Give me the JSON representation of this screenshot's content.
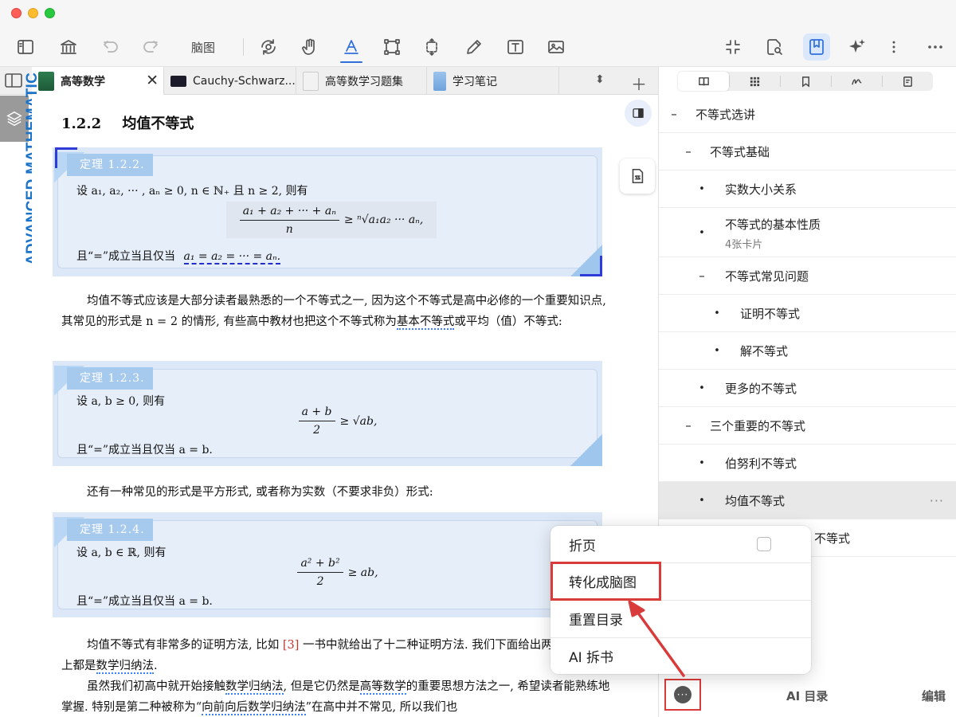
{
  "toolbar": {
    "mindmap_label": "脑图"
  },
  "tabs": [
    {
      "label": "高等数学",
      "active": true
    },
    {
      "label": "Cauchy-Schwarz...",
      "active": false
    },
    {
      "label": "高等数学习题集",
      "active": false
    },
    {
      "label": "学习笔记",
      "active": false
    }
  ],
  "spine_text": "ADVANCED MATHEMATIC",
  "doc": {
    "section_number": "1.2.2",
    "section_title": "均值不等式",
    "theorems": [
      {
        "tag": "定理 1.2.2.",
        "line1": "设 a₁, a₂, ··· , aₙ ≥ 0, n ∈ ℕ₊ 且 n ≥ 2, 则有",
        "formula_num": "a₁ + a₂ + ··· + aₙ",
        "formula_den": "n",
        "formula_rhs": "≥ ⁿ√a₁a₂ ··· aₙ,",
        "line2_prefix": "且“=”成立当且仅当",
        "line2_math": "a₁ = a₂ = ··· = aₙ."
      },
      {
        "tag": "定理 1.2.3.",
        "line1": "设 a, b ≥ 0, 则有",
        "formula_num": "a + b",
        "formula_den": "2",
        "formula_rhs": "≥ √ab,",
        "line2": "且“=”成立当且仅当 a = b."
      },
      {
        "tag": "定理 1.2.4.",
        "line1": "设 a, b ∈ ℝ, 则有",
        "formula_num": "a² + b²",
        "formula_den": "2",
        "formula_rhs": "≥ ab,",
        "line2": "且“=”成立当且仅当 a = b."
      }
    ],
    "para1_a": "均值不等式应该是大部分读者最熟悉的一个不等式之一, 因为这个不等式是高中必修的一个重要知识点, 其常见的形式是 n = 2 的情形, 有些高中教材也把这个不等式称为",
    "para1_link": "基本不等式",
    "para1_b": "或平均（值）不等式:",
    "para2": "还有一种常见的形式是平方形式, 或者称为实数（不要求非负）形式:",
    "para3_a": "均值不等式有非常多的证明方法, 比如 ",
    "para3_ref": "[3]",
    "para3_b": " 一书中就给出了十二种证明方法. 我们下面给出两种证明, 本质上都是",
    "para3_link": "数学归纳法",
    "para3_c": ".",
    "para4_a": "虽然我们初高中就开始接触",
    "para4_link1": "数学归纳法",
    "para4_b": ", 但是它仍然是",
    "para4_link2": "高等数学",
    "para4_c": "的重要思想方法之一, 希望读者能熟练地掌握. 特别是第二种被称为“",
    "para4_link3": "向前向后数学归纳法",
    "para4_d": "”在高中并不常见, 所以我们也"
  },
  "toc": [
    {
      "text": "不等式选讲",
      "level": 0,
      "mark": "–"
    },
    {
      "text": "不等式基础",
      "level": 1,
      "mark": "–"
    },
    {
      "text": "实数大小关系",
      "level": 2,
      "mark": "•"
    },
    {
      "text": "不等式的基本性质",
      "level": 2,
      "mark": "•",
      "sub": "4张卡片"
    },
    {
      "text": "不等式常见问题",
      "level": 2,
      "mark": "–"
    },
    {
      "text": "证明不等式",
      "level": 3,
      "mark": "•"
    },
    {
      "text": "解不等式",
      "level": 3,
      "mark": "•"
    },
    {
      "text": "更多的不等式",
      "level": 2,
      "mark": "•"
    },
    {
      "text": "三个重要的不等式",
      "level": 1,
      "mark": "–"
    },
    {
      "text": "伯努利不等式",
      "level": 2,
      "mark": "•"
    },
    {
      "text": "均值不等式",
      "level": 2,
      "mark": "•",
      "selected": true,
      "more": "···"
    },
    {
      "text": "不等式",
      "level": 2,
      "mark": ""
    }
  ],
  "popup": {
    "items": [
      "折页",
      "转化成脑图",
      "重置目录",
      "AI 拆书"
    ],
    "fold_checked": false
  },
  "footer": {
    "more": "···",
    "ai_toc": "AI 目录",
    "edit": "编辑"
  },
  "colors": {
    "accent": "#2f6fdd",
    "highlight_red": "#d93a3a",
    "theorem_bg": "#e6eef9",
    "spine_blue": "#1a73c8"
  }
}
